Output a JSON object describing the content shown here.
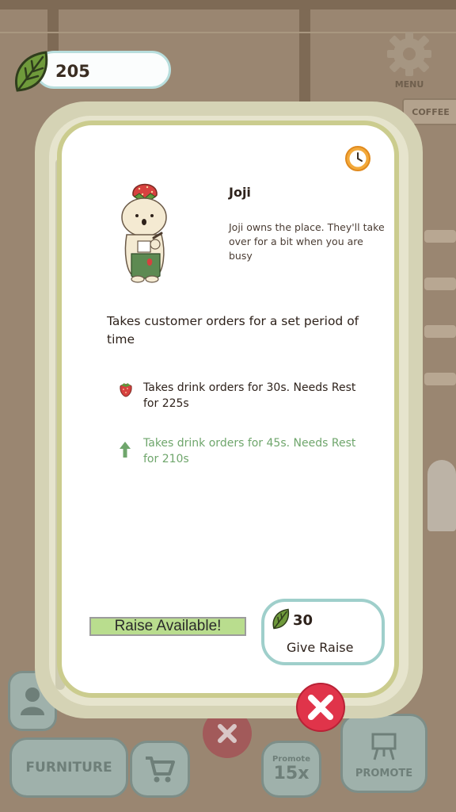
{
  "hud": {
    "leaf_count": "205",
    "menu_label": "MENU",
    "coffee_sign": "COFFEE"
  },
  "background_bar": {
    "furniture_label": "FURNITURE",
    "promote_small": "Promote",
    "promote_multiplier": "15x",
    "promote_label": "PROMOTE"
  },
  "staff": {
    "name": "Joji",
    "description": "Joji owns the place. They'll take over for a bit when you are busy",
    "ability_title": "Takes customer orders for a set period of time",
    "current_level": "Takes drink orders for 30s. Needs Rest for 225s",
    "next_level": "Takes drink orders for 45s. Needs Rest for 210s"
  },
  "raise": {
    "status": "Raise Available!",
    "cost": "30",
    "button_label": "Give Raise"
  },
  "colors": {
    "card_border": "#cbcc8e",
    "next_level_text": "#6fa66c",
    "raise_bar": "#b9dd8e",
    "raise_button_border": "#9fcfcb",
    "close_button": "#e0344a"
  },
  "icons": [
    "leaf-icon",
    "gear-icon",
    "clock-icon",
    "strawberry-icon",
    "upgrade-arrow-icon",
    "close-icon",
    "cart-icon",
    "person-icon",
    "easel-icon"
  ]
}
